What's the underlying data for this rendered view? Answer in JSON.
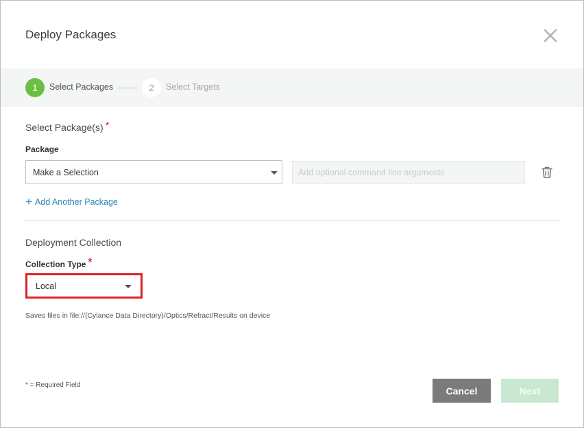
{
  "dialog": {
    "title": "Deploy Packages",
    "close_icon": "close-icon"
  },
  "steps": [
    {
      "number": "1",
      "label": "Select Packages",
      "state": "active",
      "color": "#6cbf45"
    },
    {
      "number": "2",
      "label": "Select Targets",
      "state": "inactive"
    }
  ],
  "packages": {
    "section_title": "Select Package(s)",
    "required_mark": "*",
    "field_label": "Package",
    "select_value": "Make a Selection",
    "args_placeholder": "Add optional command line arguments",
    "delete_icon": "trash-icon",
    "add_link_plus": "+",
    "add_link_label": "Add Another Package"
  },
  "collection": {
    "section_title": "Deployment Collection",
    "field_label": "Collection Type",
    "required_mark": "*",
    "select_value": "Local",
    "hint": "Saves files in file://{Cylance Data Directory}/Optics/Refract/Results on device"
  },
  "footer": {
    "required_note": "* = Required Field",
    "cancel_label": "Cancel",
    "next_label": "Next"
  },
  "colors": {
    "accent_green": "#6cbf45",
    "link_blue": "#2a86b8",
    "required_red": "#e0243a",
    "highlight_red": "#dd1f26",
    "cancel_gray": "#7b7b7b",
    "next_disabled_green": "#c8e8d2"
  }
}
